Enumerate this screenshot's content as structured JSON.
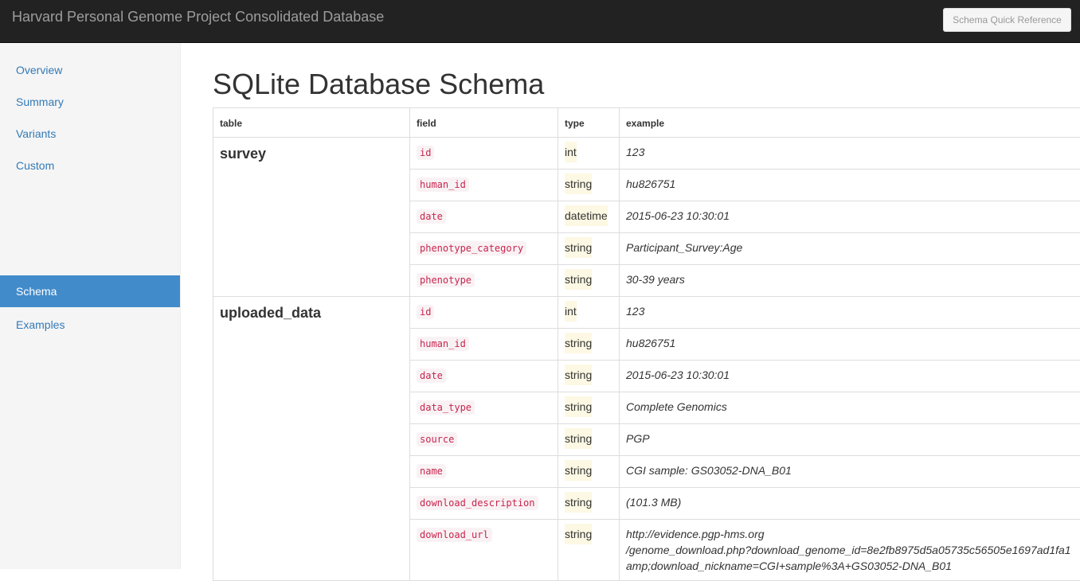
{
  "navbar": {
    "brand": "Harvard Personal Genome Project Consolidated Database",
    "quick_ref_button": "Schema Quick Reference"
  },
  "sidebar": {
    "items": [
      {
        "label": "Overview",
        "active": false
      },
      {
        "label": "Summary",
        "active": false
      },
      {
        "label": "Variants",
        "active": false
      },
      {
        "label": "Custom",
        "active": false
      },
      {
        "label": "Schema",
        "active": true
      },
      {
        "label": "Examples",
        "active": false
      }
    ]
  },
  "main": {
    "title": "SQLite Database Schema",
    "columns": [
      "table",
      "field",
      "type",
      "example"
    ],
    "tables": [
      {
        "name": "survey",
        "fields": [
          {
            "field": "id",
            "type": "int",
            "example": "123"
          },
          {
            "field": "human_id",
            "type": "string",
            "example": "hu826751"
          },
          {
            "field": "date",
            "type": "datetime",
            "example": "2015-06-23 10:30:01"
          },
          {
            "field": "phenotype_category",
            "type": "string",
            "example": "Participant_Survey:Age"
          },
          {
            "field": "phenotype",
            "type": "string",
            "example": "30-39 years"
          }
        ]
      },
      {
        "name": "uploaded_data",
        "fields": [
          {
            "field": "id",
            "type": "int",
            "example": "123"
          },
          {
            "field": "human_id",
            "type": "string",
            "example": "hu826751"
          },
          {
            "field": "date",
            "type": "string",
            "example": "2015-06-23 10:30:01"
          },
          {
            "field": "data_type",
            "type": "string",
            "example": "Complete Genomics"
          },
          {
            "field": "source",
            "type": "string",
            "example": "PGP"
          },
          {
            "field": "name",
            "type": "string",
            "example": "CGI sample: GS03052-DNA_B01"
          },
          {
            "field": "download_description",
            "type": "string",
            "example": "(101.3 MB)"
          },
          {
            "field": "download_url",
            "type": "string",
            "example_lines": [
              "http://evidence.pgp-hms.org",
              "/genome_download.php?download_genome_id=8e2fb8975d5a05735c56505e1697ad1fa1",
              "amp;download_nickname=CGI+sample%3A+GS03052-DNA_B01"
            ]
          }
        ]
      }
    ]
  }
}
